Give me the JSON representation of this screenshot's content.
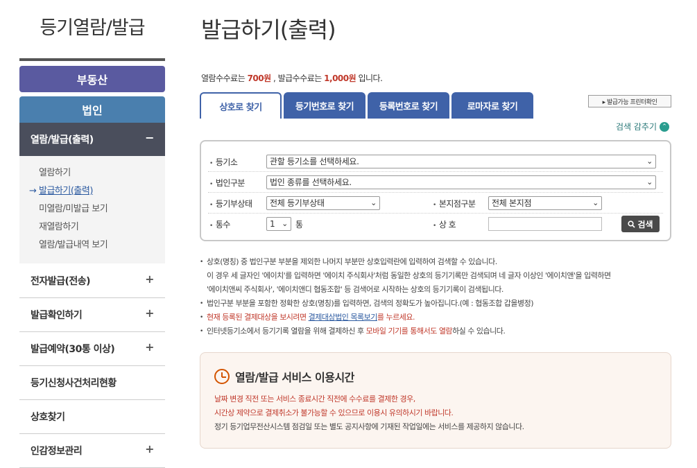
{
  "sidebar": {
    "title": "등기열람/발급",
    "realty_button": "부동산",
    "corp_button": "법인",
    "active_menu": {
      "label": "열람/발급(출력)",
      "toggle": "−"
    },
    "submenu": [
      {
        "label": "열람하기"
      },
      {
        "label": "발급하기(출력)",
        "arrow": "→"
      },
      {
        "label": "미열람/미발급 보기"
      },
      {
        "label": "재열람하기"
      },
      {
        "label": "열람/발급내역 보기"
      }
    ],
    "menu_items": [
      {
        "label": "전자발급(전송)",
        "toggle": "+"
      },
      {
        "label": "발급확인하기",
        "toggle": "+"
      },
      {
        "label": "발급예약(30통 이상)",
        "toggle": "+"
      },
      {
        "label": "등기신청사건처리현황",
        "toggle": ""
      },
      {
        "label": "상호찾기",
        "toggle": ""
      },
      {
        "label": "인감정보관리",
        "toggle": "+"
      }
    ]
  },
  "main": {
    "page_title": "발급하기(출력)",
    "fee": {
      "prefix": "열람수수료는 ",
      "view_fee": "700원",
      "middle": " , 발급수수료는 ",
      "issue_fee": "1,000원",
      "suffix": " 입니다."
    },
    "tabs": [
      "상호로 찾기",
      "등기번호로 찾기",
      "등록번호로 찾기",
      "로마자로 찾기"
    ],
    "printer_button": "▸ 발급가능 프린터확인",
    "fold_link": "검색 감추기",
    "fold_icon": "⌃",
    "form": {
      "registry_label": "등기소",
      "registry_value": "관할 등기소를 선택하세요.",
      "corp_type_label": "법인구분",
      "corp_type_value": "법인 종류를 선택하세요.",
      "status_label": "등기부상태",
      "status_value": "전체 등기부상태",
      "branch_label": "본지점구분",
      "branch_value": "전체 본지점",
      "copies_label": "통수",
      "copies_value": "1",
      "copies_unit": "통",
      "name_label": "상 호",
      "name_value": "",
      "search_button": "검색",
      "caret": "⌄"
    },
    "notes": {
      "n1": "상호(명칭) 중 법인구분 부분을 제외한 나머지 부분만 상호입력란에 입력하여 검색할 수 있습니다.",
      "n1b": "이 경우 세 글자인 '에이치'를 입력하면 '에이치 주식회사'처럼 동일한 상호의 등기기록만 검색되며 네 글자 이상인 '에이치앤'을 입력하면",
      "n1c": "'에이치앤씨 주식회사', '에이치앤디 협동조합' 등 검색어로 시작하는 상호의 등기기록이 검색됩니다.",
      "n2": "법인구분 부분을 포함한 정확한 상호(명칭)를 입력하면, 검색의 정확도가 높아집니다.(예 : 협동조합 갑을병정)",
      "n3_red1": "현재 등록된 결제대상을 보시려면 ",
      "n3_link": "결제대상법인 목록보기",
      "n3_red2": "를 누르세요.",
      "n4_a": "인터넷등기소에서 등기기록 열람을 위해 결제하신 후 ",
      "n4_red": "모바일 기기를 통해서도 열람",
      "n4_b": "하실 수 있습니다."
    },
    "service": {
      "title": "열람/발급 서비스 이용시간",
      "line1": "날짜 변경 직전 또는 서비스 종료시간 직전에 수수료를 결제한 경우,",
      "line2": "시간상 제약으로 결제취소가 불가능할 수 있으므로 이용시 유의하시기 바랍니다.",
      "line3": "정기 등기업무전산시스템 점검일 또는 별도 공지사항에 기재된 작업일에는 서비스를 제공하지 않습니다."
    }
  }
}
